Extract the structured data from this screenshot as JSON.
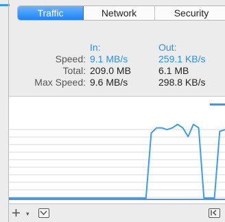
{
  "tabs": [
    {
      "label": "Traffic",
      "active": true
    },
    {
      "label": "Network",
      "active": false
    },
    {
      "label": "Security",
      "active": false
    }
  ],
  "stats": {
    "col_in": "In:",
    "col_out": "Out:",
    "rows": [
      {
        "label": "Speed:",
        "in": "9.1 MB/s",
        "out": "259.1 KB/s",
        "highlight": true
      },
      {
        "label": "Total:",
        "in": "209.0 MB",
        "out": "6.1 MB",
        "highlight": false
      },
      {
        "label": "Max Speed:",
        "in": "9.6 MB/s",
        "out": "298.8 KB/s",
        "highlight": false
      }
    ]
  },
  "graph": {
    "line_color": "#3a9cf0",
    "series_in": [
      0,
      0,
      0,
      0,
      0,
      0,
      0,
      0,
      0,
      0,
      0,
      0,
      0,
      0,
      0,
      0,
      0,
      0,
      0,
      0,
      0,
      0,
      0,
      0,
      0,
      0,
      0,
      0.74,
      0.8,
      0.8,
      0.78,
      0.8,
      0.84,
      0.8,
      0.7,
      0.84,
      0.8,
      0,
      0,
      0,
      0.76,
      0.78
    ]
  },
  "toolbar": {
    "add_icon": "+",
    "add_dropdown_icon": "▾",
    "menu_icon": "chevron-down-box-icon",
    "collapse_icon": "collapse-sidebar-icon"
  },
  "colors": {
    "accent": "#2e9cf2",
    "in_value": "#2a8ff0"
  }
}
